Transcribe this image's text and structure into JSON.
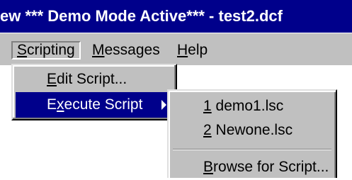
{
  "window": {
    "title": "ew *** Demo Mode Active*** - test2.dcf"
  },
  "menubar": {
    "items": [
      {
        "pre": "",
        "key": "S",
        "post": "cripting"
      },
      {
        "pre": "",
        "key": "M",
        "post": "essages"
      },
      {
        "pre": "",
        "key": "H",
        "post": "elp"
      }
    ]
  },
  "scripting_menu": {
    "items": [
      {
        "pre": "",
        "key": "E",
        "post": "dit Script..."
      },
      {
        "pre": "E",
        "key": "x",
        "post": "ecute Script"
      }
    ]
  },
  "execute_submenu": {
    "items": [
      {
        "key": "1",
        "post": " demo1.lsc"
      },
      {
        "key": "2",
        "post": " Newone.lsc"
      },
      {
        "pre": "",
        "key": "B",
        "post": "rowse for Script..."
      }
    ]
  },
  "colors": {
    "titlebar": "#00008b",
    "menu_face": "#c0c0c0",
    "highlight": "#00008b"
  },
  "icons": {
    "submenu_arrow": "submenu-arrow-icon"
  }
}
